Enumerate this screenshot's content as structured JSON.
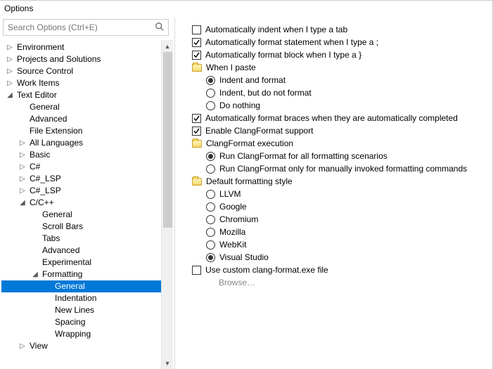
{
  "window": {
    "title": "Options"
  },
  "search": {
    "placeholder": "Search Options (Ctrl+E)",
    "value": ""
  },
  "tree": [
    {
      "label": "Environment",
      "indent": 0,
      "twisty": "▷"
    },
    {
      "label": "Projects and Solutions",
      "indent": 0,
      "twisty": "▷"
    },
    {
      "label": "Source Control",
      "indent": 0,
      "twisty": "▷"
    },
    {
      "label": "Work Items",
      "indent": 0,
      "twisty": "▷"
    },
    {
      "label": "Text Editor",
      "indent": 0,
      "twisty": "◢"
    },
    {
      "label": "General",
      "indent": 1,
      "twisty": ""
    },
    {
      "label": "Advanced",
      "indent": 1,
      "twisty": ""
    },
    {
      "label": "File Extension",
      "indent": 1,
      "twisty": ""
    },
    {
      "label": "All Languages",
      "indent": 1,
      "twisty": "▷"
    },
    {
      "label": "Basic",
      "indent": 1,
      "twisty": "▷"
    },
    {
      "label": "C#",
      "indent": 1,
      "twisty": "▷"
    },
    {
      "label": "C#_LSP",
      "indent": 1,
      "twisty": "▷"
    },
    {
      "label": "C#_LSP",
      "indent": 1,
      "twisty": "▷"
    },
    {
      "label": "C/C++",
      "indent": 1,
      "twisty": "◢"
    },
    {
      "label": "General",
      "indent": 2,
      "twisty": ""
    },
    {
      "label": "Scroll Bars",
      "indent": 2,
      "twisty": ""
    },
    {
      "label": "Tabs",
      "indent": 2,
      "twisty": ""
    },
    {
      "label": "Advanced",
      "indent": 2,
      "twisty": ""
    },
    {
      "label": "Experimental",
      "indent": 2,
      "twisty": ""
    },
    {
      "label": "Formatting",
      "indent": 2,
      "twisty": "◢"
    },
    {
      "label": "General",
      "indent": 3,
      "twisty": "",
      "selected": true
    },
    {
      "label": "Indentation",
      "indent": 3,
      "twisty": ""
    },
    {
      "label": "New Lines",
      "indent": 3,
      "twisty": ""
    },
    {
      "label": "Spacing",
      "indent": 3,
      "twisty": ""
    },
    {
      "label": "Wrapping",
      "indent": 3,
      "twisty": ""
    },
    {
      "label": "View",
      "indent": 1,
      "twisty": "▷"
    }
  ],
  "options": {
    "auto_indent_tab": {
      "label": "Automatically indent when I type a tab",
      "checked": false
    },
    "auto_format_semicolon": {
      "label": "Automatically format statement when I type a ;",
      "checked": true
    },
    "auto_format_brace": {
      "label": "Automatically format block when I type a }",
      "checked": true
    },
    "when_paste_header": "When I paste",
    "paste_indent_format": {
      "label": "Indent and format",
      "checked": true
    },
    "paste_indent_only": {
      "label": "Indent, but do not format",
      "checked": false
    },
    "paste_nothing": {
      "label": "Do nothing",
      "checked": false
    },
    "auto_format_auto_braces": {
      "label": "Automatically format braces when they are automatically completed",
      "checked": true
    },
    "enable_clangformat": {
      "label": "Enable ClangFormat support",
      "checked": true
    },
    "clang_exec_header": "ClangFormat execution",
    "clang_all": {
      "label": "Run ClangFormat for all formatting scenarios",
      "checked": true
    },
    "clang_manual": {
      "label": "Run ClangFormat only for manually invoked formatting commands",
      "checked": false
    },
    "style_header": "Default formatting style",
    "style_llvm": {
      "label": "LLVM",
      "checked": false
    },
    "style_google": {
      "label": "Google",
      "checked": false
    },
    "style_chromium": {
      "label": "Chromium",
      "checked": false
    },
    "style_mozilla": {
      "label": "Mozilla",
      "checked": false
    },
    "style_webkit": {
      "label": "WebKit",
      "checked": false
    },
    "style_vs": {
      "label": "Visual Studio",
      "checked": true
    },
    "use_custom_exe": {
      "label": "Use custom clang-format.exe file",
      "checked": false
    },
    "browse": "Browse…"
  }
}
